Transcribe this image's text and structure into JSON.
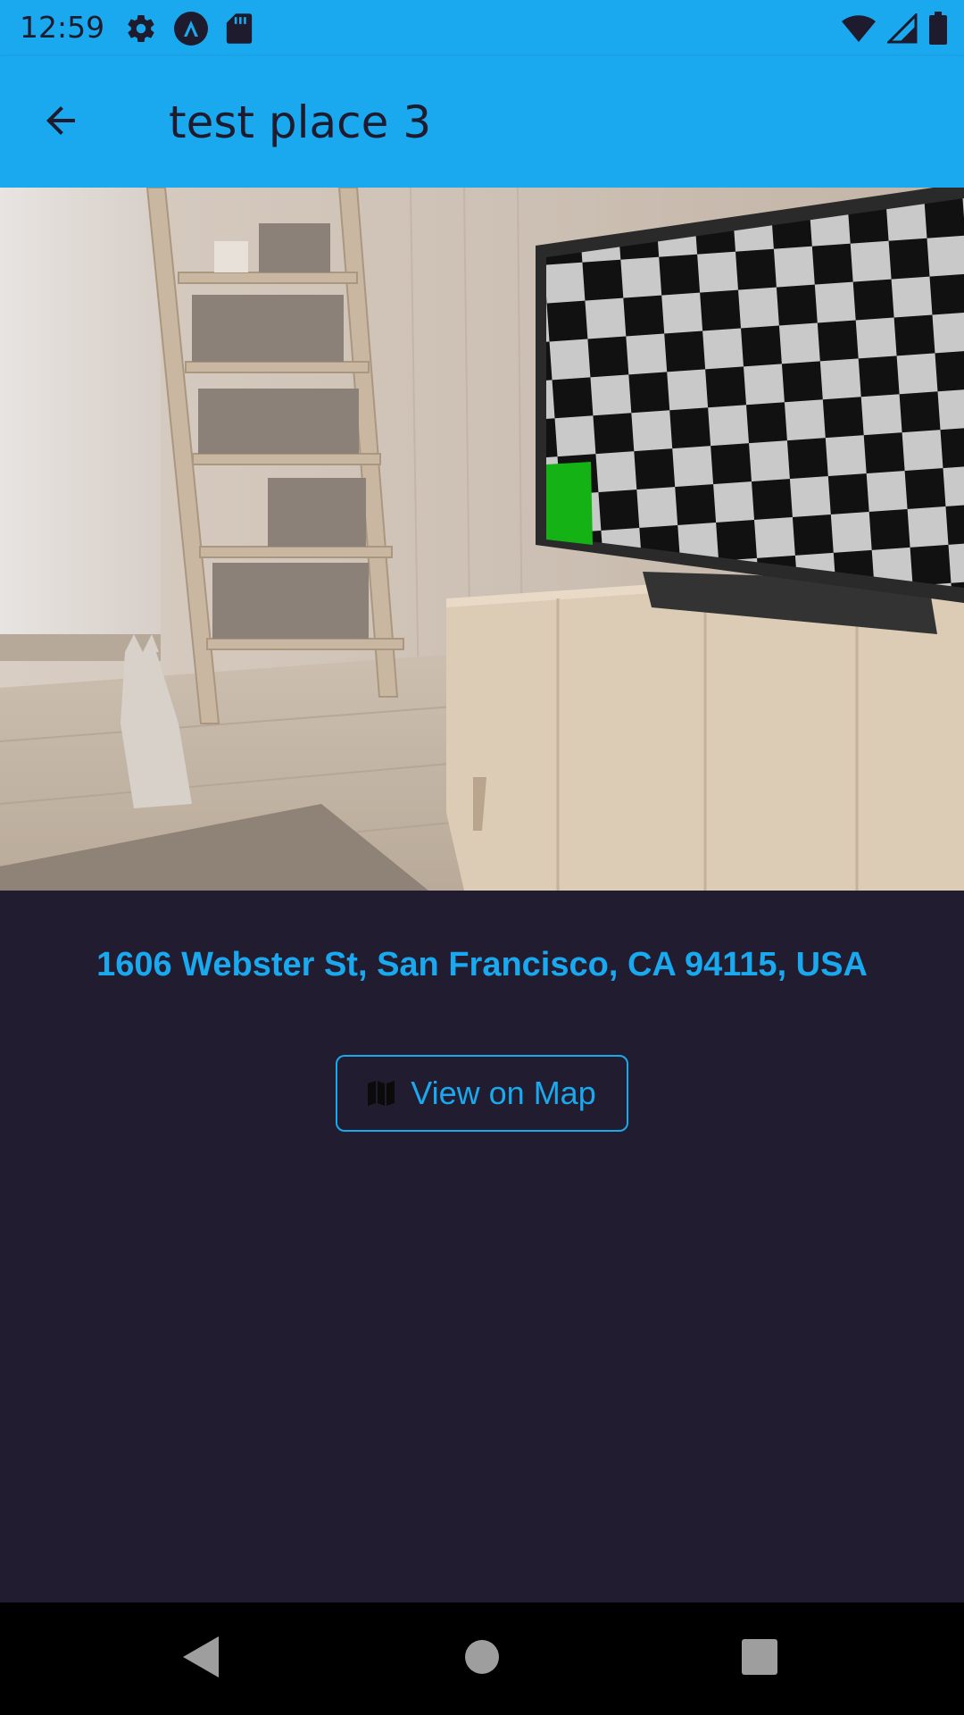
{
  "status_bar": {
    "time": "12:59",
    "left_icons": [
      "settings-icon",
      "app-a-icon",
      "sd-card-icon"
    ],
    "right_icons": [
      "wifi-icon",
      "cell-signal-icon",
      "battery-icon"
    ]
  },
  "app_bar": {
    "title": "test place 3",
    "back_icon": "arrow-left-icon",
    "background_color": "#1aa9ef"
  },
  "place": {
    "address": "1606 Webster St, San Francisco, CA 94115, USA",
    "address_color": "#1aa9ef",
    "view_on_map_label": "View on Map",
    "view_on_map_icon": "map-icon"
  },
  "nav_bar": {
    "buttons": [
      "back-triangle-icon",
      "home-circle-icon",
      "recents-square-icon"
    ]
  },
  "colors": {
    "accent": "#1aa9ef",
    "background": "#211c30",
    "text_dark": "#1f1b2e"
  }
}
